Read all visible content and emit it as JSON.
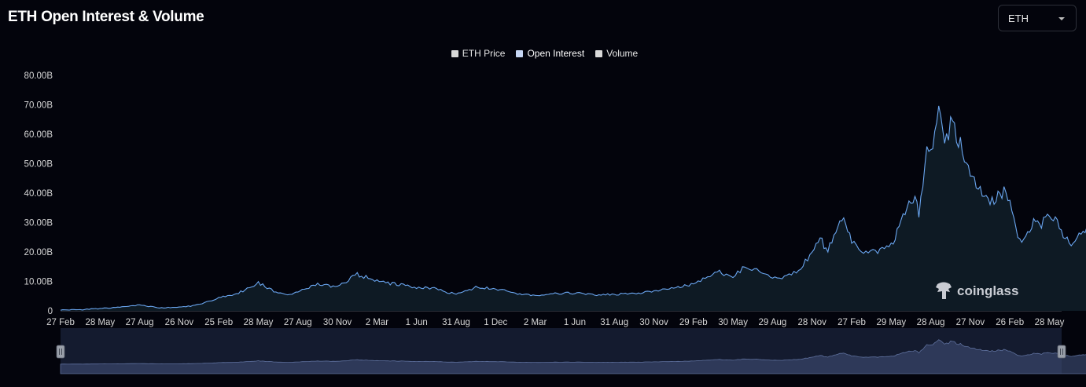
{
  "title": "ETH Open Interest & Volume",
  "coin_select": {
    "value": "ETH"
  },
  "legend": [
    {
      "label": "ETH Price",
      "color": "#d9d9d9"
    },
    {
      "label": "Open Interest",
      "color": "#c7d7f5"
    },
    {
      "label": "Volume",
      "color": "#d9d9d9"
    }
  ],
  "watermark": "coinglass",
  "colors": {
    "background": "#03040c",
    "line": "#6aa6f0",
    "area": "#0e1a24",
    "navigator": "#28324e"
  },
  "chart_data": {
    "type": "area",
    "title": "ETH Open Interest & Volume",
    "ylabel": "",
    "xlabel": "",
    "ylim": [
      0,
      80
    ],
    "y_unit": "B",
    "y_ticks": [
      "0",
      "10.00B",
      "20.00B",
      "30.00B",
      "40.00B",
      "50.00B",
      "60.00B",
      "70.00B",
      "80.00B"
    ],
    "x_ticks": [
      "27 Feb",
      "28 May",
      "27 Aug",
      "26 Nov",
      "25 Feb",
      "28 May",
      "27 Aug",
      "30 Nov",
      "2 Mar",
      "1 Jun",
      "31 Aug",
      "1 Dec",
      "2 Mar",
      "1 Jun",
      "31 Aug",
      "30 Nov",
      "29 Feb",
      "30 May",
      "29 Aug",
      "28 Nov",
      "27 Feb",
      "29 May",
      "28 Aug",
      "27 Nov",
      "26 Feb",
      "28 May"
    ],
    "grid": false,
    "legend_position": "top-center",
    "series": [
      {
        "name": "Open Interest",
        "x_tick_index": [
          0,
          0.5,
          1,
          1.5,
          2,
          2.5,
          3,
          3.4,
          3.7,
          4,
          4.5,
          5,
          5.5,
          5.8,
          6,
          6.5,
          7,
          7.5,
          8,
          8.5,
          9,
          9.5,
          10,
          10.5,
          11,
          11.5,
          12,
          12.5,
          13,
          13.5,
          14,
          14.5,
          15,
          15.5,
          16,
          16.3,
          16.6,
          17,
          17.3,
          17.6,
          18,
          18.3,
          18.6,
          19,
          19.2,
          19.4,
          19.6,
          19.8,
          20,
          20.3,
          20.6,
          21,
          21.2,
          21.4,
          21.6,
          21.7,
          21.8,
          21.9,
          22,
          22.1,
          22.2,
          22.35,
          22.5,
          22.7,
          22.9,
          23.1,
          23.3,
          23.5,
          23.7,
          23.85,
          24,
          24.2,
          24.4,
          24.6,
          24.8,
          25,
          25.2,
          25.4,
          25.6,
          25.8,
          26,
          26.2
        ],
        "values": [
          0.3,
          0.4,
          0.8,
          1.2,
          2.0,
          1.0,
          1.2,
          1.8,
          3.0,
          4.5,
          6.0,
          9.5,
          6.0,
          5.5,
          6.5,
          9.0,
          8.0,
          12.5,
          10.0,
          9.0,
          8.0,
          7.5,
          5.5,
          8.0,
          7.5,
          6.0,
          5.0,
          6.0,
          6.0,
          5.5,
          5.5,
          6.0,
          6.5,
          8.0,
          9.0,
          11.0,
          13.5,
          11.0,
          15.5,
          14.0,
          11.0,
          11.5,
          13.0,
          20.0,
          25.0,
          20.0,
          28.0,
          31.0,
          24.0,
          19.0,
          20.0,
          22.0,
          28.0,
          35.0,
          38.0,
          33.0,
          42.0,
          58.0,
          52.0,
          62.0,
          68.0,
          55.0,
          63.0,
          58.0,
          52.0,
          45.0,
          40.0,
          36.0,
          39.0,
          41.0,
          38.0,
          25.0,
          24.0,
          30.0,
          29.0,
          33.0,
          31.0,
          24.0,
          23.0,
          27.0,
          27.5,
          25.5
        ]
      }
    ]
  }
}
